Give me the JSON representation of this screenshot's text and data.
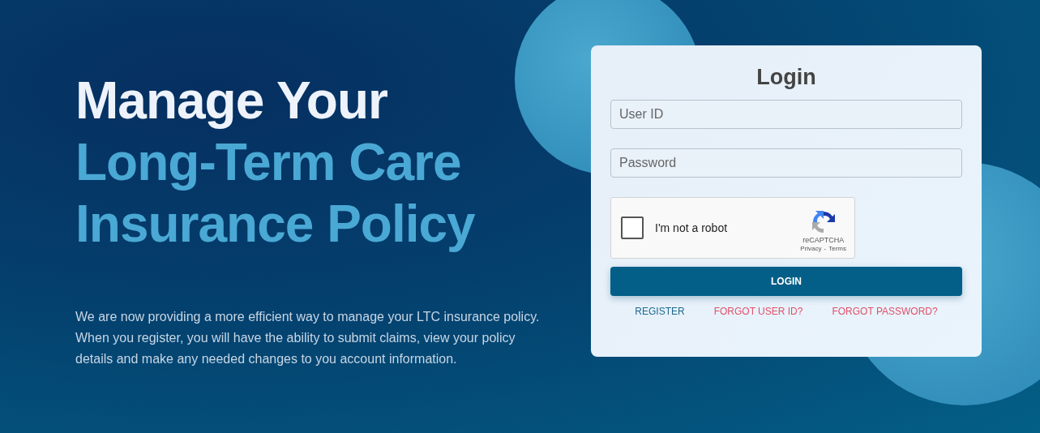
{
  "hero": {
    "title_lines": [
      {
        "text": "Manage Your",
        "highlight": false
      },
      {
        "text": "Long-Term Care",
        "highlight": true
      },
      {
        "text": "Insurance Policy",
        "highlight": true
      }
    ],
    "description": "We are now providing a more efficient way to manage your LTC insurance policy. When you register, you will have the ability to submit claims, view your policy details and make any needed changes to you account information."
  },
  "login": {
    "title": "Login",
    "fields": [
      {
        "placeholder": "User ID"
      },
      {
        "placeholder": "Password"
      }
    ],
    "captcha": {
      "label": "I'm not a robot",
      "checked": false,
      "brand": "reCAPTCHA",
      "privacy": "Privacy",
      "separator": "-",
      "terms": "Terms"
    },
    "button": "LOGIN",
    "links": [
      {
        "label": "REGISTER",
        "color": "#1b6a8f"
      },
      {
        "label": "FORGOT USER ID?",
        "color": "#e0506a"
      },
      {
        "label": "FORGOT PASSWORD?",
        "color": "#e0506a"
      }
    ]
  }
}
